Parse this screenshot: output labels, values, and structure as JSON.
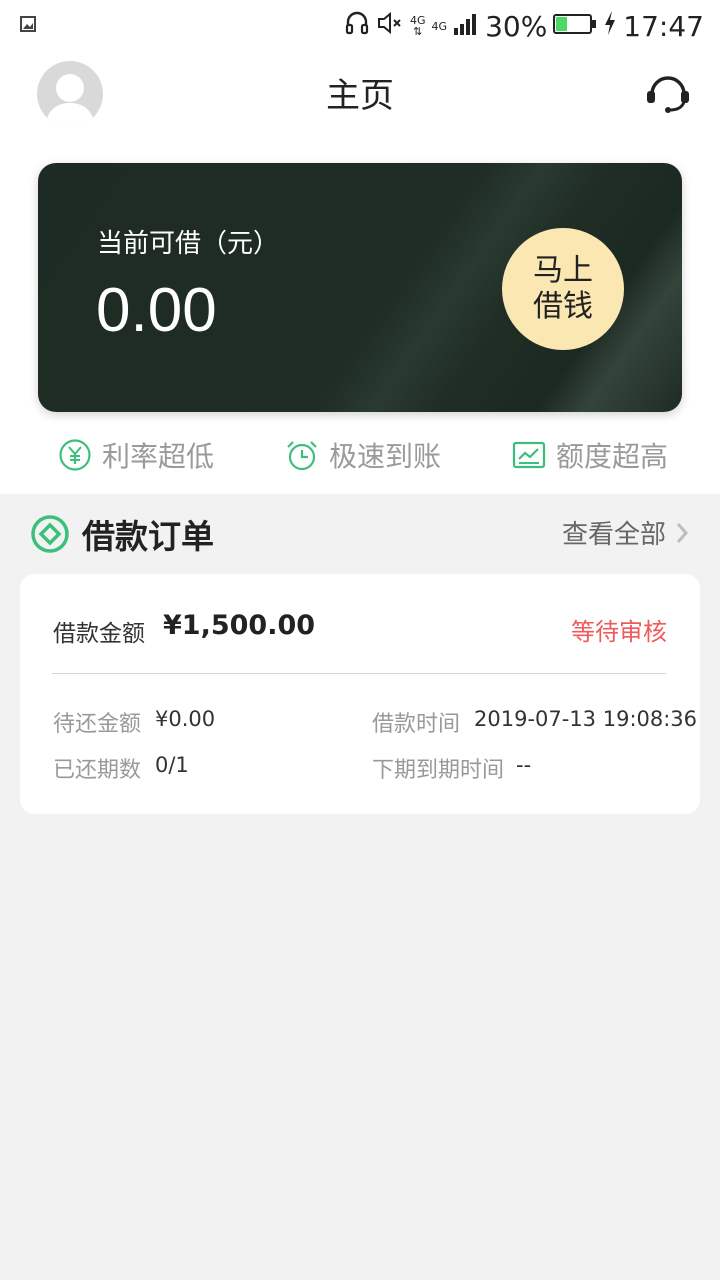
{
  "status_bar": {
    "network_left": "4G",
    "network_right": "4G",
    "battery": "30%",
    "time": "17:47"
  },
  "header": {
    "title": "主页"
  },
  "card": {
    "label": "当前可借（元）",
    "amount": "0.00",
    "button_line1": "马上",
    "button_line2": "借钱"
  },
  "features": [
    {
      "icon": "yen-circle-icon",
      "label": "利率超低"
    },
    {
      "icon": "alarm-clock-icon",
      "label": "极速到账"
    },
    {
      "icon": "chart-icon",
      "label": "额度超高"
    }
  ],
  "orders": {
    "title": "借款订单",
    "view_all": "查看全部",
    "item": {
      "amount_label": "借款金额",
      "amount": "¥1,500.00",
      "status": "等待审核",
      "remaining_label": "待还金额",
      "remaining": "¥0.00",
      "time_label": "借款时间",
      "time": "2019-07-13 19:08:36",
      "periods_label": "已还期数",
      "periods": "0/1",
      "next_due_label": "下期到期时间",
      "next_due": "--"
    }
  },
  "colors": {
    "accent_green": "#3dbf7c",
    "status_red": "#ef5a5a",
    "card_bg": "#1e2b24",
    "button_bg": "#fbe7b2"
  }
}
